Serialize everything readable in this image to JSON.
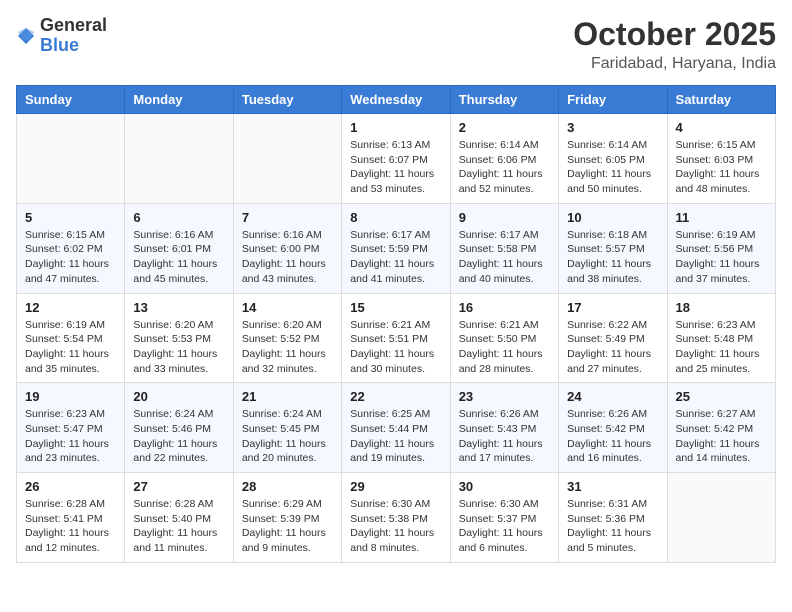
{
  "logo": {
    "general": "General",
    "blue": "Blue"
  },
  "header": {
    "month": "October 2025",
    "location": "Faridabad, Haryana, India"
  },
  "weekdays": [
    "Sunday",
    "Monday",
    "Tuesday",
    "Wednesday",
    "Thursday",
    "Friday",
    "Saturday"
  ],
  "weeks": [
    [
      {
        "day": "",
        "info": ""
      },
      {
        "day": "",
        "info": ""
      },
      {
        "day": "",
        "info": ""
      },
      {
        "day": "1",
        "info": "Sunrise: 6:13 AM\nSunset: 6:07 PM\nDaylight: 11 hours\nand 53 minutes."
      },
      {
        "day": "2",
        "info": "Sunrise: 6:14 AM\nSunset: 6:06 PM\nDaylight: 11 hours\nand 52 minutes."
      },
      {
        "day": "3",
        "info": "Sunrise: 6:14 AM\nSunset: 6:05 PM\nDaylight: 11 hours\nand 50 minutes."
      },
      {
        "day": "4",
        "info": "Sunrise: 6:15 AM\nSunset: 6:03 PM\nDaylight: 11 hours\nand 48 minutes."
      }
    ],
    [
      {
        "day": "5",
        "info": "Sunrise: 6:15 AM\nSunset: 6:02 PM\nDaylight: 11 hours\nand 47 minutes."
      },
      {
        "day": "6",
        "info": "Sunrise: 6:16 AM\nSunset: 6:01 PM\nDaylight: 11 hours\nand 45 minutes."
      },
      {
        "day": "7",
        "info": "Sunrise: 6:16 AM\nSunset: 6:00 PM\nDaylight: 11 hours\nand 43 minutes."
      },
      {
        "day": "8",
        "info": "Sunrise: 6:17 AM\nSunset: 5:59 PM\nDaylight: 11 hours\nand 41 minutes."
      },
      {
        "day": "9",
        "info": "Sunrise: 6:17 AM\nSunset: 5:58 PM\nDaylight: 11 hours\nand 40 minutes."
      },
      {
        "day": "10",
        "info": "Sunrise: 6:18 AM\nSunset: 5:57 PM\nDaylight: 11 hours\nand 38 minutes."
      },
      {
        "day": "11",
        "info": "Sunrise: 6:19 AM\nSunset: 5:56 PM\nDaylight: 11 hours\nand 37 minutes."
      }
    ],
    [
      {
        "day": "12",
        "info": "Sunrise: 6:19 AM\nSunset: 5:54 PM\nDaylight: 11 hours\nand 35 minutes."
      },
      {
        "day": "13",
        "info": "Sunrise: 6:20 AM\nSunset: 5:53 PM\nDaylight: 11 hours\nand 33 minutes."
      },
      {
        "day": "14",
        "info": "Sunrise: 6:20 AM\nSunset: 5:52 PM\nDaylight: 11 hours\nand 32 minutes."
      },
      {
        "day": "15",
        "info": "Sunrise: 6:21 AM\nSunset: 5:51 PM\nDaylight: 11 hours\nand 30 minutes."
      },
      {
        "day": "16",
        "info": "Sunrise: 6:21 AM\nSunset: 5:50 PM\nDaylight: 11 hours\nand 28 minutes."
      },
      {
        "day": "17",
        "info": "Sunrise: 6:22 AM\nSunset: 5:49 PM\nDaylight: 11 hours\nand 27 minutes."
      },
      {
        "day": "18",
        "info": "Sunrise: 6:23 AM\nSunset: 5:48 PM\nDaylight: 11 hours\nand 25 minutes."
      }
    ],
    [
      {
        "day": "19",
        "info": "Sunrise: 6:23 AM\nSunset: 5:47 PM\nDaylight: 11 hours\nand 23 minutes."
      },
      {
        "day": "20",
        "info": "Sunrise: 6:24 AM\nSunset: 5:46 PM\nDaylight: 11 hours\nand 22 minutes."
      },
      {
        "day": "21",
        "info": "Sunrise: 6:24 AM\nSunset: 5:45 PM\nDaylight: 11 hours\nand 20 minutes."
      },
      {
        "day": "22",
        "info": "Sunrise: 6:25 AM\nSunset: 5:44 PM\nDaylight: 11 hours\nand 19 minutes."
      },
      {
        "day": "23",
        "info": "Sunrise: 6:26 AM\nSunset: 5:43 PM\nDaylight: 11 hours\nand 17 minutes."
      },
      {
        "day": "24",
        "info": "Sunrise: 6:26 AM\nSunset: 5:42 PM\nDaylight: 11 hours\nand 16 minutes."
      },
      {
        "day": "25",
        "info": "Sunrise: 6:27 AM\nSunset: 5:42 PM\nDaylight: 11 hours\nand 14 minutes."
      }
    ],
    [
      {
        "day": "26",
        "info": "Sunrise: 6:28 AM\nSunset: 5:41 PM\nDaylight: 11 hours\nand 12 minutes."
      },
      {
        "day": "27",
        "info": "Sunrise: 6:28 AM\nSunset: 5:40 PM\nDaylight: 11 hours\nand 11 minutes."
      },
      {
        "day": "28",
        "info": "Sunrise: 6:29 AM\nSunset: 5:39 PM\nDaylight: 11 hours\nand 9 minutes."
      },
      {
        "day": "29",
        "info": "Sunrise: 6:30 AM\nSunset: 5:38 PM\nDaylight: 11 hours\nand 8 minutes."
      },
      {
        "day": "30",
        "info": "Sunrise: 6:30 AM\nSunset: 5:37 PM\nDaylight: 11 hours\nand 6 minutes."
      },
      {
        "day": "31",
        "info": "Sunrise: 6:31 AM\nSunset: 5:36 PM\nDaylight: 11 hours\nand 5 minutes."
      },
      {
        "day": "",
        "info": ""
      }
    ]
  ]
}
